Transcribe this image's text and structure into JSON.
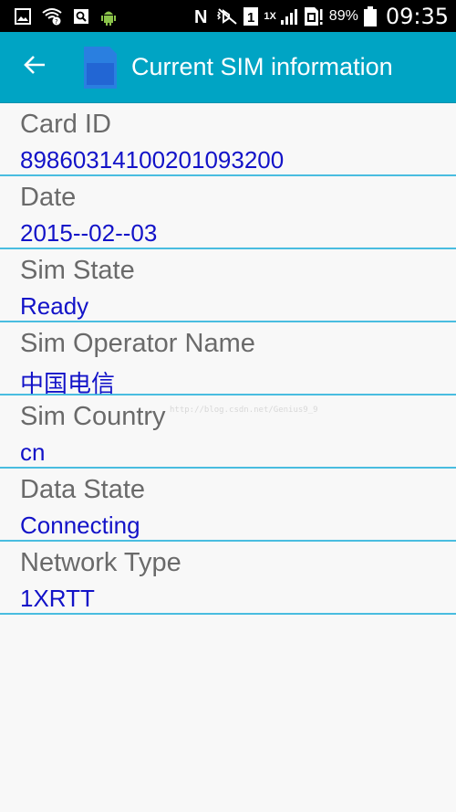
{
  "status_bar": {
    "left_icons": [
      "gallery-notification-icon",
      "wifi-unknown-icon",
      "search-app-icon",
      "android-debug-icon"
    ],
    "right_icons": [
      "nfc-icon",
      "vibrate-mute-icon",
      "sim1-icon",
      "signal-icon",
      "sim-alert-icon",
      "battery-icon"
    ],
    "network_type": "1X",
    "battery_percent": "89%",
    "time": "09:35"
  },
  "app_bar": {
    "title": "Current SIM information",
    "back_icon": "arrow-left-icon",
    "logo_icon": "sim-card-icon",
    "accent_color": "#00a4c4"
  },
  "rows": [
    {
      "label": "Card ID",
      "value": "89860314100201093200"
    },
    {
      "label": "Date",
      "value": "2015--02--03"
    },
    {
      "label": "Sim State",
      "value": "Ready"
    },
    {
      "label": "Sim Operator Name",
      "value": "中国电信"
    },
    {
      "label": "Sim Country",
      "value": "cn"
    },
    {
      "label": "Data State",
      "value": "Connecting"
    },
    {
      "label": "Network Type",
      "value": "1XRTT"
    }
  ],
  "watermark": "http://blog.csdn.net/Genius9_9"
}
